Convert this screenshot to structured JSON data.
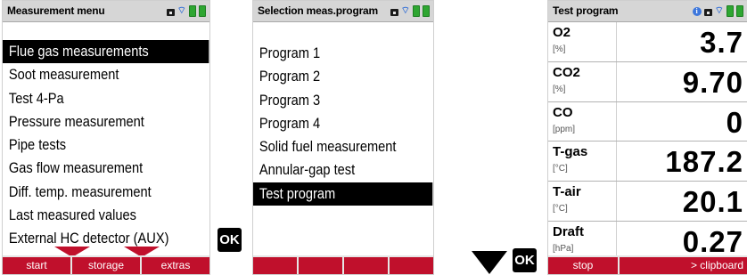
{
  "screen1": {
    "title": "Measurement menu",
    "items": [
      {
        "label": "Flue gas measurements",
        "selected": true
      },
      {
        "label": "Soot measurement",
        "selected": false
      },
      {
        "label": "Test 4-Pa",
        "selected": false
      },
      {
        "label": "Pressure measurement",
        "selected": false
      },
      {
        "label": "Pipe tests",
        "selected": false
      },
      {
        "label": "Gas flow measurement",
        "selected": false
      },
      {
        "label": "Diff. temp. measurement",
        "selected": false
      },
      {
        "label": "Last measured values",
        "selected": false
      },
      {
        "label": "External HC detector (AUX)",
        "selected": false
      }
    ],
    "softkeys": [
      "start",
      "storage",
      "extras"
    ]
  },
  "screen2": {
    "title": "Selection meas.program",
    "items": [
      {
        "label": "Program 1",
        "selected": false
      },
      {
        "label": "Program 2",
        "selected": false
      },
      {
        "label": "Program 3",
        "selected": false
      },
      {
        "label": "Program 4",
        "selected": false
      },
      {
        "label": "Solid fuel measurement",
        "selected": false
      },
      {
        "label": "Annular-gap test",
        "selected": false
      },
      {
        "label": "Test program",
        "selected": true
      }
    ],
    "softkeys": [
      "",
      "",
      "",
      ""
    ]
  },
  "screen3": {
    "title": "Test program",
    "readings": [
      {
        "param": "O2",
        "unit": "[%]",
        "value": "3.7"
      },
      {
        "param": "CO2",
        "unit": "[%]",
        "value": "9.70"
      },
      {
        "param": "CO",
        "unit": "[ppm]",
        "value": "0"
      },
      {
        "param": "T-gas",
        "unit": "[°C]",
        "value": "187.2"
      },
      {
        "param": "T-air",
        "unit": "[°C]",
        "value": "20.1"
      },
      {
        "param": "Draft",
        "unit": "[hPa]",
        "value": "0.27"
      }
    ],
    "softkeys": [
      "stop",
      "> clipboard"
    ]
  },
  "keys": {
    "ok_label": "OK"
  },
  "colors": {
    "softkey_bar": "#c0102c",
    "titlebar": "#d6d6d6",
    "selection": "#000000",
    "battery": "#2ea631"
  },
  "icons": [
    "lock-icon",
    "wireless-icon",
    "info-icon",
    "battery-icon",
    "down-arrow-icon"
  ]
}
